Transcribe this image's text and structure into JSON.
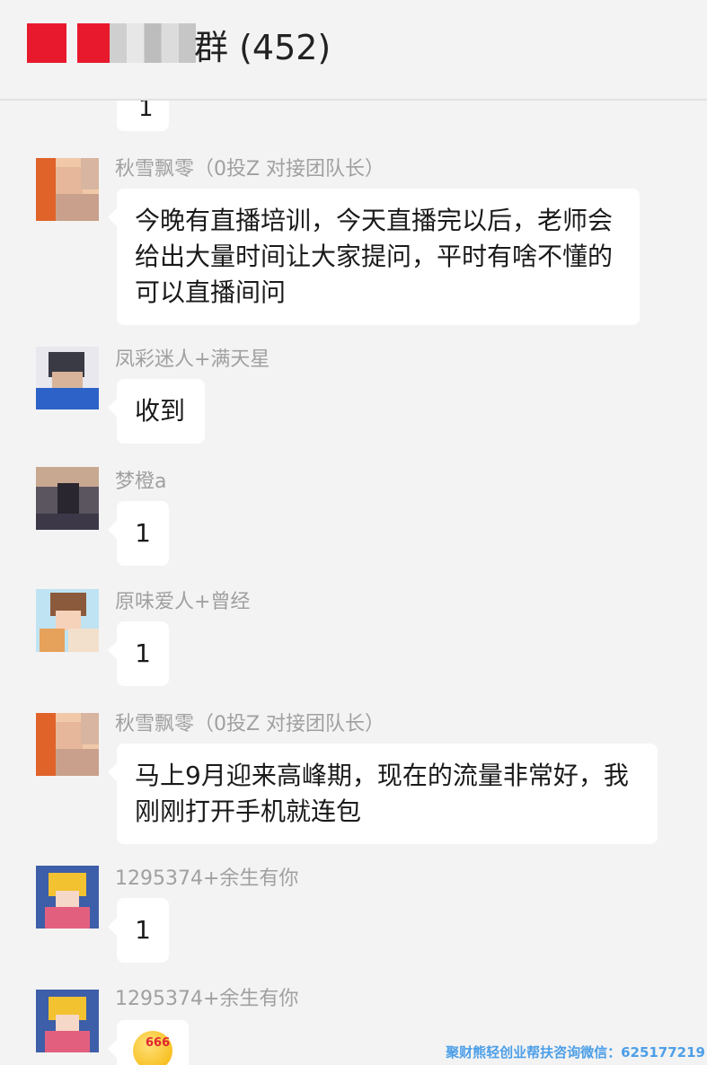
{
  "header": {
    "title": "群 (452)"
  },
  "partial_top_message": {
    "text": "1"
  },
  "messages": [
    {
      "sender": "秋雪飘零（0投Z 对接团队长）",
      "lines": [
        "今晚有直播培训，今天直播完以后，老师会",
        "给出大量时间让大家提问，平时有啥不懂的",
        "可以直播间问"
      ]
    },
    {
      "sender": "凤彩迷人+满天星",
      "lines": [
        "收到"
      ]
    },
    {
      "sender": "梦橙a",
      "lines": [
        "1"
      ]
    },
    {
      "sender": "原味爱人+曾经",
      "lines": [
        "1"
      ]
    },
    {
      "sender": "秋雪飘零（0投Z 对接团队长）",
      "lines": [
        "马上9月迎来高峰期，现在的流量非常好，我",
        "刚刚打开手机就连包"
      ]
    },
    {
      "sender": "1295374+余生有你",
      "lines": [
        "1"
      ]
    },
    {
      "sender": "1295374+余生有你",
      "emoji": "666",
      "emoji_name": "emoji-666"
    }
  ],
  "watermark": "聚财熊轻创业帮扶咨询微信：625177219",
  "colors": {
    "background": "#f3f3f3",
    "bubble": "#ffffff",
    "name": "#a0a0a0",
    "watermark": "#4d9fe8"
  }
}
